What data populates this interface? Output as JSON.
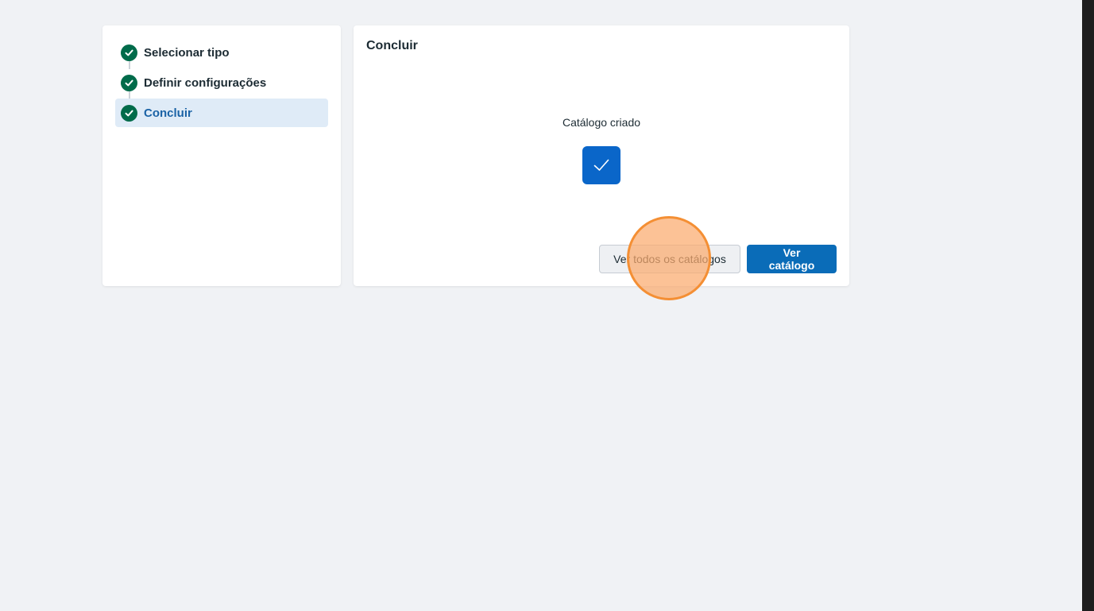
{
  "steps": [
    {
      "label": "Selecionar tipo",
      "status": "complete"
    },
    {
      "label": "Definir configurações",
      "status": "complete"
    },
    {
      "label": "Concluir",
      "status": "active"
    }
  ],
  "main": {
    "title": "Concluir",
    "success_message": "Catálogo criado",
    "success_icon": "checkmark-icon"
  },
  "actions": {
    "view_all_label": "Ver todos os catálogos",
    "view_catalog_label": "Ver catálogo"
  },
  "colors": {
    "page_background": "#f0f2f5",
    "step_check": "#006b4a",
    "active_step_background": "#dfebf7",
    "active_step_text": "#1b63a6",
    "primary_button": "#0a6cb8",
    "success_badge": "#0a66c9",
    "click_marker": "#f48f34"
  }
}
